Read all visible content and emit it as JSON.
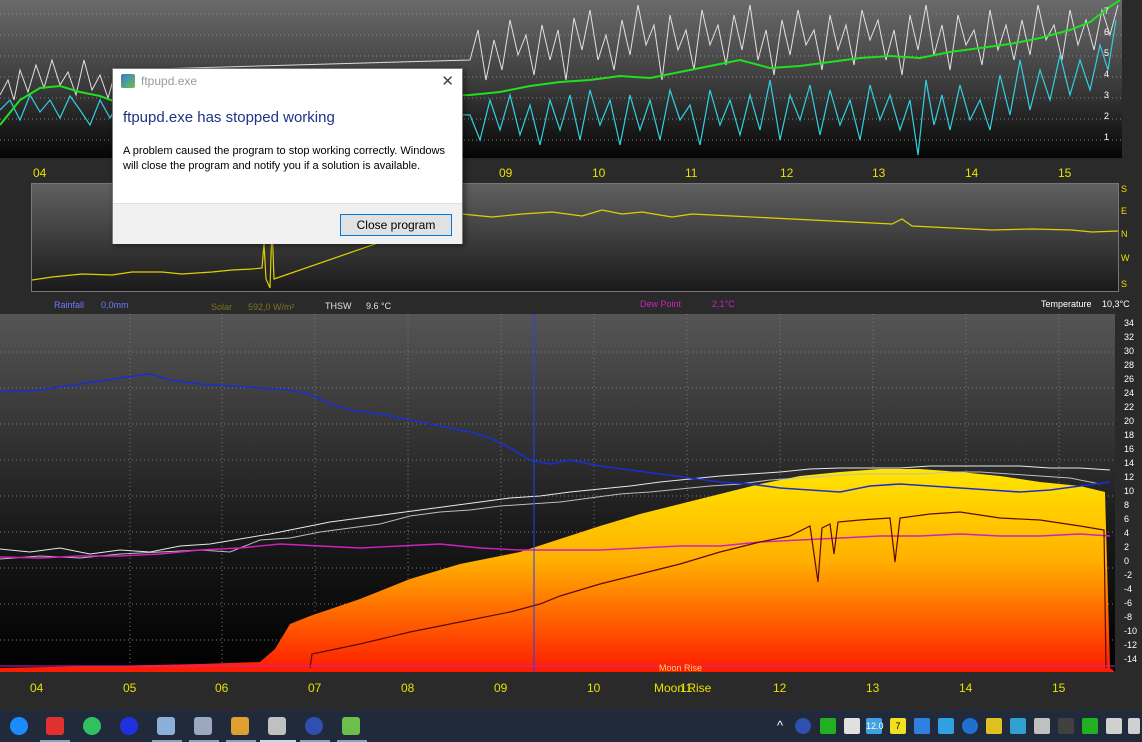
{
  "top_graph": {
    "x_ticks": [
      "04",
      "09",
      "10",
      "11",
      "12",
      "13",
      "14",
      "15"
    ],
    "right_ticks": [
      "7",
      "6",
      "5",
      "4",
      "3",
      "2",
      "1"
    ]
  },
  "direction_graph": {
    "labels": [
      "S",
      "E",
      "N",
      "W",
      "S"
    ]
  },
  "legend": {
    "rainfall_label": "Rainfall",
    "rainfall_value": "0,0mm",
    "solar_label": "Solar",
    "solar_value": "592,0 W/m²",
    "thsw_label": "THSW",
    "thsw_value": "9.6 °C",
    "dewpoint_label": "Dew Point",
    "dewpoint_value": "2,1°C",
    "temperature_label": "Temperature",
    "temperature_value": "10,3°C"
  },
  "main_graph": {
    "y_ticks": [
      "34",
      "32",
      "30",
      "28",
      "26",
      "24",
      "22",
      "20",
      "18",
      "16",
      "14",
      "12",
      "10",
      "8",
      "6",
      "4",
      "2",
      "0",
      "-2",
      "-4",
      "-6",
      "-8",
      "-10",
      "-12",
      "-14"
    ],
    "x_ticks": [
      "04",
      "05",
      "06",
      "07",
      "08",
      "09",
      "10",
      "11",
      "12",
      "13",
      "14",
      "15"
    ],
    "moon_rise_small": "Moon Rise",
    "moon_rise_large": "Moon Rise"
  },
  "dialog": {
    "title": "ftpupd.exe",
    "heading": "ftpupd.exe has stopped working",
    "body": "A problem caused the program to stop working correctly. Windows will close the program and notify you if a solution is available.",
    "button": "Close program"
  },
  "taskbar": {
    "tray_temp": "12.0",
    "tray_count": "7"
  },
  "colors": {
    "axis_text": "#e8e000",
    "temperature_blue": "#1a2fd0",
    "dew_point_magenta": "#d020c0",
    "solar_yellow": "#ffe600",
    "wind_green": "#20e020",
    "gust_cyan": "#30d0e0"
  }
}
